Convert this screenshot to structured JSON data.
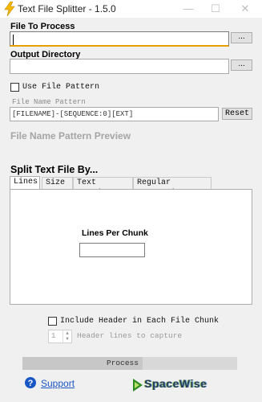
{
  "window": {
    "title": "Text File Splitter - 1.5.0",
    "controls": {
      "minimize": "—",
      "maximize": "☐",
      "close": "✕"
    }
  },
  "file_to_process": {
    "label": "File To Process",
    "value": "",
    "browse_label": "..."
  },
  "output_directory": {
    "label": "Output Directory",
    "value": "",
    "browse_label": "..."
  },
  "use_file_pattern": {
    "label": "Use File Pattern",
    "checked": false
  },
  "file_name_pattern": {
    "label": "File Name Pattern",
    "value": "[FILENAME]-[SEQUENCE:0][EXT]",
    "reset_label": "Reset",
    "preview_label": "File Name Pattern Preview"
  },
  "split": {
    "heading": "Split Text File By...",
    "tabs": [
      "Lines",
      "Size",
      "Text Boundary",
      "Regular Expression"
    ],
    "active_tab": "Lines",
    "lines_per_chunk_label": "Lines Per Chunk",
    "lines_per_chunk_value": ""
  },
  "include_header": {
    "label": "Include Header in Each File Chunk",
    "checked": false
  },
  "header_lines": {
    "value": "1",
    "label": "Header lines to capture"
  },
  "process": {
    "label": "Process"
  },
  "footer": {
    "support_label": "Support",
    "logo_text": "SpaceWise"
  },
  "colors": {
    "focus_border": "#e8a000",
    "link": "#1a56c4",
    "icon": "#f5b800"
  }
}
